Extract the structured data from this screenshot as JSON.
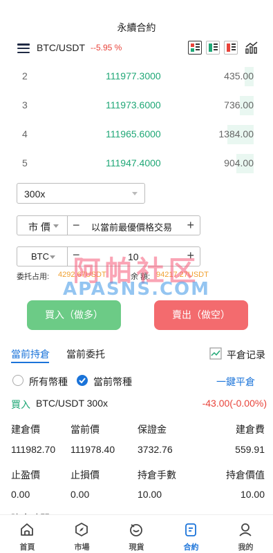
{
  "page_title": "永續合約",
  "header": {
    "pair": "BTC/USDT",
    "change": "--5.95 %"
  },
  "order_book": [
    {
      "index": "2",
      "price": "111977.3000",
      "qty": "435.00",
      "depth": 0.05
    },
    {
      "index": "3",
      "price": "111973.6000",
      "qty": "736.00",
      "depth": 0.08
    },
    {
      "index": "4",
      "price": "111965.6000",
      "qty": "1384.00",
      "depth": 0.15
    },
    {
      "index": "5",
      "price": "111947.4000",
      "qty": "904.00",
      "depth": 0.1
    }
  ],
  "leverage": {
    "value": "300x"
  },
  "order_type": {
    "label": "市 價",
    "minus": "−",
    "best_price_text": "以當前最優價格交易",
    "plus": "+"
  },
  "quantity": {
    "unit": "BTC",
    "minus": "−",
    "value": "10",
    "plus": "+"
  },
  "funds": {
    "margin_label": "委托占用:",
    "margin_value": "4292.67USDT",
    "balance_label": "余 額:",
    "balance_value": "94217.27USDT"
  },
  "watermark": {
    "line1": "阿帕社区",
    "line2": "APASNS.COM"
  },
  "buttons": {
    "buy": "買入（做多）",
    "sell": "賣出（做空）"
  },
  "tabs": {
    "positions": "當前持倉",
    "orders": "當前委托",
    "history": "平倉记录"
  },
  "filter": {
    "all_symbols": "所有幣種",
    "current_symbol": "當前幣種",
    "close_all": "一鍵平倉"
  },
  "position": {
    "side": "買入",
    "symbol_leverage": "BTC/USDT 300x",
    "pnl": "-43.00(-0.00%)",
    "fields_row1": [
      {
        "label": "建倉價",
        "value": "111982.70"
      },
      {
        "label": "當前價",
        "value": "111978.40"
      },
      {
        "label": "保證金",
        "value": "3732.76"
      },
      {
        "label": "建倉費",
        "value": "559.91"
      }
    ],
    "fields_row2": [
      {
        "label": "止盈價",
        "value": "0.00"
      },
      {
        "label": "止損價",
        "value": "0.00"
      },
      {
        "label": "持倉手數",
        "value": "10.00"
      },
      {
        "label": "持倉價值",
        "value": "10.00"
      }
    ],
    "partial_label": "建倉時間"
  },
  "tabbar": [
    {
      "label": "首頁",
      "icon": "home-icon"
    },
    {
      "label": "市場",
      "icon": "compass-icon"
    },
    {
      "label": "現貨",
      "icon": "spot-icon"
    },
    {
      "label": "合約",
      "icon": "contract-icon"
    },
    {
      "label": "我的",
      "icon": "user-icon"
    }
  ],
  "colors": {
    "accent": "#1a73d9",
    "up": "#1fa776",
    "down": "#e8433a",
    "buy": "#6ccb86",
    "sell": "#f36b6e"
  }
}
